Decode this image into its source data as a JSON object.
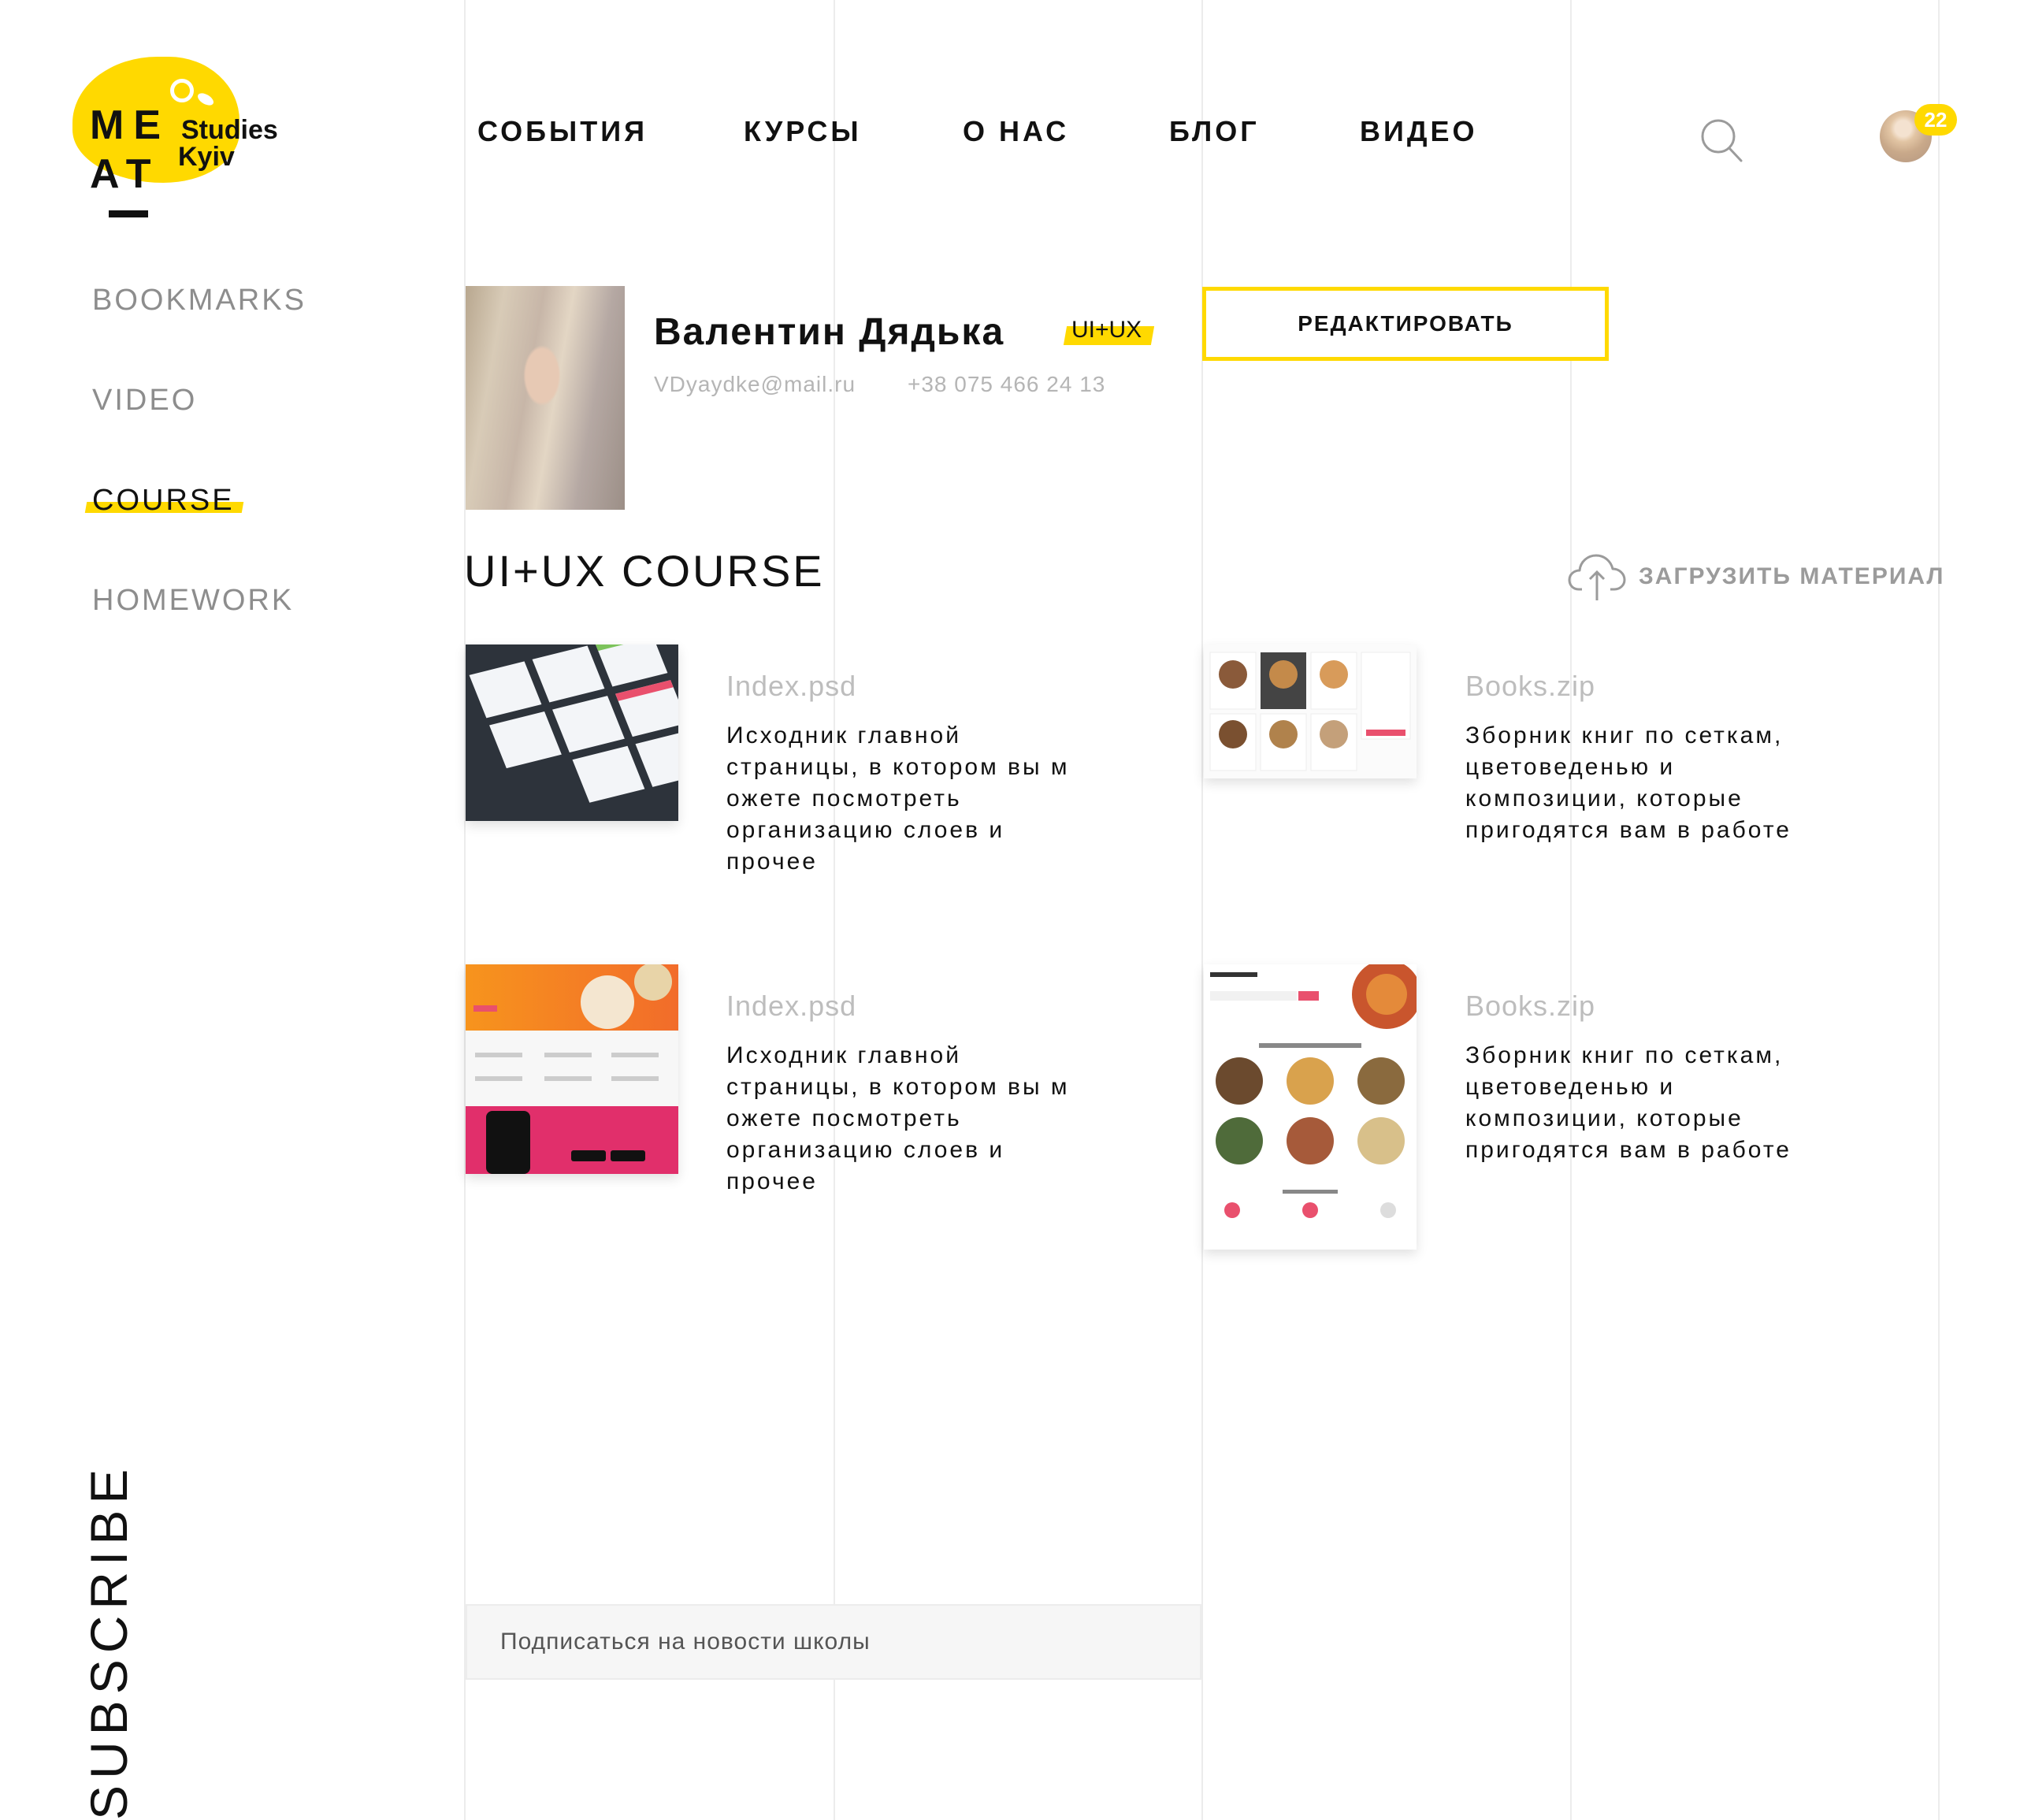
{
  "logo": {
    "letters_line1": "ME",
    "letters_line2": "AT",
    "studies": "Studies",
    "city": "Kyiv",
    "accent_color": "#ffd900"
  },
  "sidebar": {
    "items": [
      {
        "label": "BOOKMARKS",
        "active": false
      },
      {
        "label": "VIDEO",
        "active": false
      },
      {
        "label": "COURSE",
        "active": true
      },
      {
        "label": "HOMEWORK",
        "active": false
      }
    ],
    "subscribe_vertical": "SUBSCRIBE"
  },
  "nav": {
    "items": [
      "СОБЫТИЯ",
      "КУРСЫ",
      "О НАС",
      "БЛОГ",
      "ВИДЕО"
    ],
    "search_icon": "search-icon",
    "notifications_count": "22"
  },
  "profile": {
    "name": "Валентин Дядька",
    "tag": "UI+UX",
    "email": "VDyaydke@mail.ru",
    "phone": "+38 075 466 24 13",
    "edit_label": "РЕДАКТИРОВАТЬ"
  },
  "course": {
    "title": "UI+UX COURSE",
    "upload_label": "ЗАГРУЗИТЬ МАТЕРИАЛ",
    "materials": [
      {
        "file": "Index.psd",
        "desc": [
          "Исходник главной",
          "страницы, в котором вы м",
          "ожете посмотреть",
          "организацию слоев и",
          "прочее"
        ]
      },
      {
        "file": "Books.zip",
        "desc": [
          "Зборник книг по сеткам,",
          "цветоведенью и",
          "композиции, которые",
          "пригодятся вам в работе"
        ]
      },
      {
        "file": "Index.psd",
        "desc": [
          "Исходник главной",
          "страницы, в котором вы м",
          "ожете посмотреть",
          "организацию слоев и",
          "прочее"
        ]
      },
      {
        "file": "Books.zip",
        "desc": [
          "Зборник книг по сеткам,",
          "цветоведенью и",
          "композиции, которые",
          "пригодятся вам в работе"
        ]
      }
    ]
  },
  "subscribe": {
    "placeholder": "Подписаться на новости школы"
  }
}
